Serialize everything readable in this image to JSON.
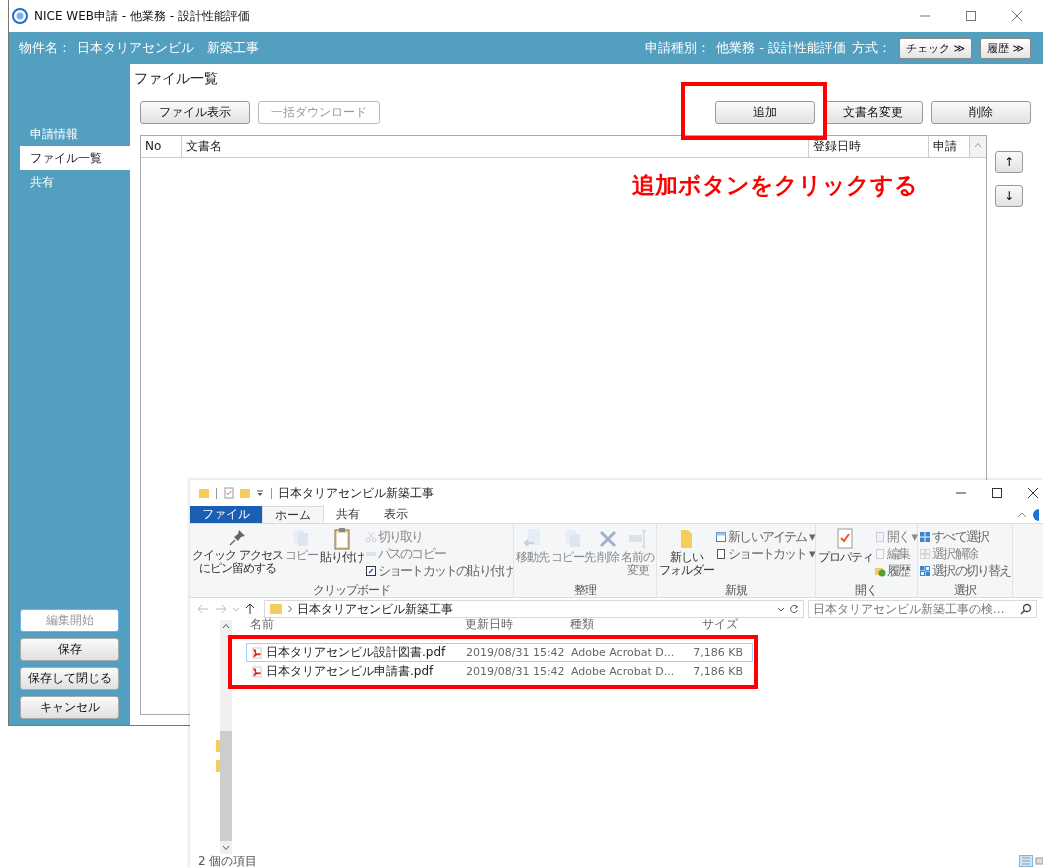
{
  "app": {
    "title": "NICE WEB申請 - 他業務 - 設計性能評価",
    "property_label": "物件名：",
    "property_name": "日本タリアセンビル　新築工事",
    "type_label": "申請種別：",
    "type_value": "他業務 - 設計性能評価",
    "method_label": "方式：",
    "header_buttons": [
      {
        "label": "チェック ≫"
      },
      {
        "label": "履歴 ≫"
      }
    ],
    "sidebar": {
      "items": [
        {
          "label": "申請情報",
          "selected": false
        },
        {
          "label": "ファイル一覧",
          "selected": true
        },
        {
          "label": "共有",
          "selected": false
        }
      ],
      "buttons": [
        {
          "label": "編集開始",
          "disabled": true
        },
        {
          "label": "保存",
          "disabled": false
        },
        {
          "label": "保存して閉じる",
          "disabled": false
        },
        {
          "label": "キャンセル",
          "disabled": false
        }
      ]
    },
    "panel_title": "ファイル一覧",
    "toolbar_left": [
      {
        "label": "ファイル表示",
        "disabled": false
      },
      {
        "label": "一括ダウンロード",
        "disabled": true
      }
    ],
    "toolbar_right": [
      {
        "label": "追加",
        "disabled": false
      },
      {
        "label": "文書名変更",
        "disabled": false
      },
      {
        "label": "削除",
        "disabled": false
      }
    ],
    "table": {
      "columns": [
        "No",
        "文書名",
        "登録日時",
        "申請"
      ]
    },
    "order_buttons": [
      "↑",
      "↓"
    ]
  },
  "annotation": "追加ボタンをクリックする",
  "explorer": {
    "title": "日本タリアセンビル新築工事",
    "tabs": [
      {
        "label": "ファイル",
        "kind": "file",
        "selected": false
      },
      {
        "label": "ホーム",
        "kind": "tab",
        "selected": true
      },
      {
        "label": "共有",
        "kind": "tab",
        "selected": false
      },
      {
        "label": "表示",
        "kind": "tab",
        "selected": false
      }
    ],
    "groups": [
      {
        "label": "クリップボード",
        "items": [
          {
            "lines": [
              "クイック アクセス",
              "にピン留めする"
            ],
            "kind": "large",
            "disabled": false
          },
          {
            "lines": [
              "コピー"
            ],
            "kind": "large",
            "disabled": true
          },
          {
            "lines": [
              "貼り付け"
            ],
            "kind": "large",
            "disabled": false
          },
          {
            "label": "切り取り",
            "kind": "small",
            "disabled": true
          },
          {
            "label": "パスのコピー",
            "kind": "small",
            "disabled": true
          },
          {
            "label": "ショートカットの貼り付け",
            "kind": "small",
            "disabled": false
          }
        ]
      },
      {
        "label": "整理",
        "items": [
          {
            "lines": [
              "移動先"
            ],
            "kind": "large",
            "disabled": true
          },
          {
            "lines": [
              "コピー先"
            ],
            "kind": "large",
            "disabled": true
          },
          {
            "lines": [
              "削除"
            ],
            "kind": "large",
            "disabled": true
          },
          {
            "lines": [
              "名前の",
              "変更"
            ],
            "kind": "large",
            "disabled": true
          }
        ]
      },
      {
        "label": "新規",
        "items": [
          {
            "lines": [
              "新しい",
              "フォルダー"
            ],
            "kind": "large",
            "disabled": false
          },
          {
            "label": "新しいアイテム ▾",
            "kind": "small",
            "disabled": false
          },
          {
            "label": "ショートカット ▾",
            "kind": "small",
            "disabled": false
          }
        ]
      },
      {
        "label": "開く",
        "items": [
          {
            "lines": [
              "プロパティ"
            ],
            "kind": "large",
            "disabled": false
          },
          {
            "label": "開く ▾",
            "kind": "small",
            "disabled": true
          },
          {
            "label": "編集",
            "kind": "small",
            "disabled": true
          },
          {
            "label": "履歴",
            "kind": "small",
            "disabled": false
          }
        ]
      },
      {
        "label": "選択",
        "items": [
          {
            "label": "すべて選択",
            "kind": "small",
            "disabled": false
          },
          {
            "label": "選択解除",
            "kind": "small",
            "disabled": true
          },
          {
            "label": "選択の切り替え",
            "kind": "small",
            "disabled": false
          }
        ]
      }
    ],
    "path": "日本タリアセンビル新築工事",
    "search": {
      "placeholder": "日本タリアセンビル新築工事の検..."
    },
    "columns": [
      "名前",
      "更新日時",
      "種類",
      "サイズ"
    ],
    "files": [
      {
        "name": "日本タリアセンビル設計図書.pdf",
        "date": "2019/08/31 15:42",
        "type": "Adobe Acrobat D...",
        "size": "7,186 KB",
        "selected": true
      },
      {
        "name": "日本タリアセンビル申請書.pdf",
        "date": "2019/08/31 15:42",
        "type": "Adobe Acrobat D...",
        "size": "7,186 KB",
        "selected": false
      }
    ],
    "status": "2 個の項目"
  }
}
